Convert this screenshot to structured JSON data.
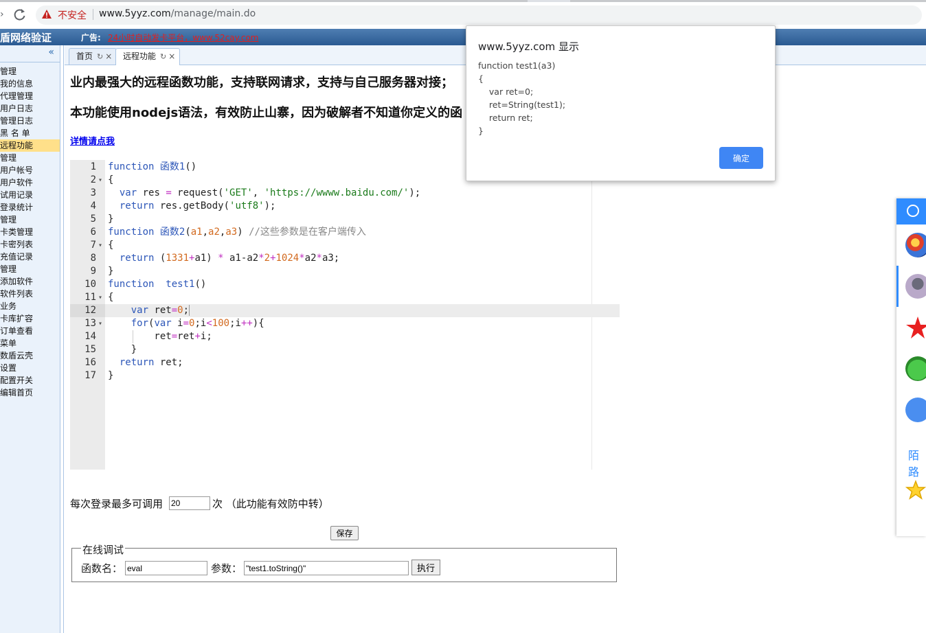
{
  "browser": {
    "security_label": "不安全",
    "url_host": "www.5yyz.com",
    "url_path": "/manage/main.do"
  },
  "header": {
    "title": "盾网络验证",
    "ad_label": "广告:",
    "ad_text": "24小时自动发卡平台，www.52cay.com"
  },
  "sidebar": {
    "collapse": "«",
    "items": [
      {
        "label": "管理"
      },
      {
        "label": "我的信息"
      },
      {
        "label": "代理管理"
      },
      {
        "label": "用户日志"
      },
      {
        "label": "管理日志"
      },
      {
        "label": "黑 名 单"
      },
      {
        "label": "远程功能",
        "active": true
      },
      {
        "label": "管理"
      },
      {
        "label": "用户帐号"
      },
      {
        "label": "用户软件"
      },
      {
        "label": "试用记录"
      },
      {
        "label": "登录统计"
      },
      {
        "label": "管理"
      },
      {
        "label": "卡类管理"
      },
      {
        "label": "卡密列表"
      },
      {
        "label": "充值记录"
      },
      {
        "label": "管理"
      },
      {
        "label": "添加软件"
      },
      {
        "label": "软件列表"
      },
      {
        "label": "业务"
      },
      {
        "label": "卡库扩容"
      },
      {
        "label": "订单查看"
      },
      {
        "label": "菜单"
      },
      {
        "label": "数盾云壳"
      },
      {
        "label": "设置"
      },
      {
        "label": "配置开关"
      },
      {
        "label": "编辑首页"
      }
    ]
  },
  "tabs": [
    {
      "label": "首页",
      "refresh": "↻",
      "close": "×"
    },
    {
      "label": "远程功能",
      "refresh": "↻",
      "close": "×",
      "active": true
    }
  ],
  "content": {
    "heading1": "业内最强大的远程函数功能，支持联网请求，支持与自己服务器对接；",
    "heading2": "本功能使用nodejs语法，有效防止山寨，因为破解者不知道你定义的函",
    "details_link": "详情请点我",
    "code_lines": [
      "1",
      "2",
      "3",
      "4",
      "5",
      "6",
      "7",
      "8",
      "9",
      "10",
      "11",
      "12",
      "13",
      "14",
      "15",
      "16",
      "17"
    ],
    "limit_label": "每次登录最多可调用",
    "limit_value": "20",
    "limit_suffix": "次  （此功能有效防中转）",
    "save_label": "保存",
    "debug_legend": "在线调试",
    "fn_label": "函数名：",
    "fn_value": "eval",
    "arg_label": "参数：",
    "arg_value": "\"test1.toString()\"",
    "run_label": "执行"
  },
  "dialog": {
    "title": "www.5yyz.com 显示",
    "message": "function test1(a3)\n{\n    var ret=0;\n    ret=String(test1);\n    return ret;\n}",
    "ok_label": "确定"
  },
  "right_panel": {
    "text": "陌路"
  },
  "colors": {
    "header_blue": "#2a5a92",
    "sidebar_active": "#ffe08a",
    "dialog_button": "#3f86f4",
    "insecure_red": "#c5221f"
  }
}
